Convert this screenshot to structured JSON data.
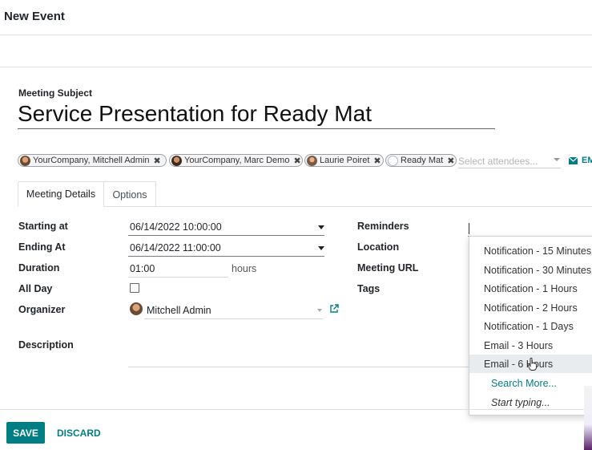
{
  "header": {
    "title": "New Event"
  },
  "subject": {
    "label": "Meeting Subject",
    "value": "Service Presentation for Ready Mat"
  },
  "attendees": {
    "tags": [
      {
        "name": "YourCompany, Mitchell Admin",
        "remove_icon": "✖"
      },
      {
        "name": "YourCompany, Marc Demo",
        "remove_icon": "✖"
      },
      {
        "name": "Laurie Poiret",
        "remove_icon": "✖"
      },
      {
        "name": "Ready Mat",
        "remove_icon": "✖"
      }
    ],
    "placeholder": "Select attendees...",
    "email_button_label": "EM"
  },
  "tabs": [
    {
      "label": "Meeting Details",
      "active": true
    },
    {
      "label": "Options",
      "active": false
    }
  ],
  "form": {
    "starting_at": {
      "label": "Starting at",
      "value": "06/14/2022 10:00:00"
    },
    "ending_at": {
      "label": "Ending At",
      "value": "06/14/2022 11:00:00"
    },
    "duration": {
      "label": "Duration",
      "value": "01:00",
      "unit": "hours"
    },
    "all_day": {
      "label": "All Day",
      "checked": false
    },
    "organizer": {
      "label": "Organizer",
      "value": "Mitchell Admin"
    },
    "description": {
      "label": "Description"
    },
    "reminders": {
      "label": "Reminders"
    },
    "location": {
      "label": "Location"
    },
    "meeting_url": {
      "label": "Meeting URL"
    },
    "tags": {
      "label": "Tags"
    }
  },
  "reminders_dropdown": {
    "options": [
      "Notification - 15 Minutes",
      "Notification - 30 Minutes",
      "Notification - 1 Hours",
      "Notification - 2 Hours",
      "Notification - 1 Days",
      "Email - 3 Hours",
      "Email - 6 Hours"
    ],
    "hovered_option": "Email - 6 Hours",
    "search_more": "Search More...",
    "start_typing": "Start typing..."
  },
  "footer": {
    "save_label": "SAVE",
    "discard_label": "DISCARD"
  },
  "colors": {
    "primary": "#017e84",
    "text": "#212529",
    "border": "#dee2e6"
  },
  "icons": {
    "tag_remove": "close-icon",
    "email": "envelope-icon",
    "organizer_link": "external-link-icon",
    "field_dropdown": "caret-down-icon"
  }
}
